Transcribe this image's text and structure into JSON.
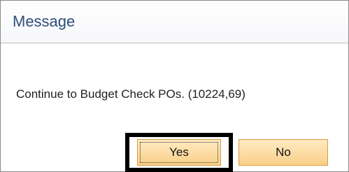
{
  "dialog": {
    "title": "Message",
    "message": "Continue to Budget Check POs. (10224,69)"
  },
  "buttons": {
    "yes_label": "Yes",
    "no_label": "No"
  },
  "colors": {
    "title_text": "#2e4e7a",
    "button_fill": "#f9cf88",
    "button_border": "#d79c43",
    "highlight_frame": "#000000"
  }
}
